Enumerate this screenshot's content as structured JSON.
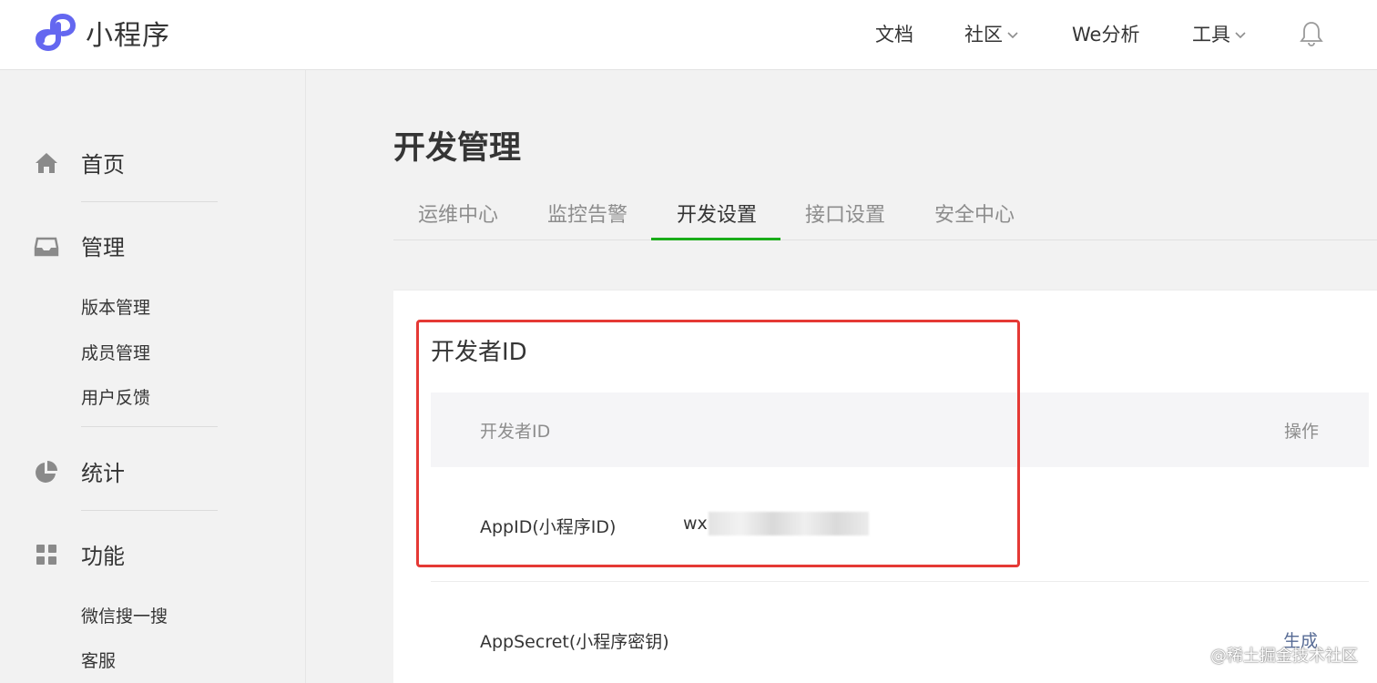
{
  "header": {
    "app_name": "小程序",
    "nav": [
      {
        "label": "文档"
      },
      {
        "label": "社区"
      },
      {
        "label": "We分析"
      },
      {
        "label": "工具"
      }
    ]
  },
  "sidebar": {
    "groups": [
      {
        "label": "首页",
        "icon": "home-icon"
      },
      {
        "label": "管理",
        "icon": "inbox-icon",
        "items": [
          "版本管理",
          "成员管理",
          "用户反馈"
        ]
      },
      {
        "label": "统计",
        "icon": "pie-chart-icon"
      },
      {
        "label": "功能",
        "icon": "grid-icon",
        "items": [
          "微信搜一搜",
          "客服"
        ]
      }
    ]
  },
  "main": {
    "title": "开发管理",
    "tabs": [
      "运维中心",
      "监控告警",
      "开发设置",
      "接口设置",
      "安全中心"
    ],
    "active_tab": "开发设置",
    "section": {
      "title": "开发者ID",
      "columns": [
        "开发者ID",
        "操作"
      ],
      "rows": [
        {
          "label": "AppID(小程序ID)",
          "value": "wx",
          "action": ""
        },
        {
          "label": "AppSecret(小程序密钥)",
          "value": "",
          "action": "生成"
        }
      ]
    }
  },
  "watermark": "@稀土掘金技术社区",
  "colors": {
    "accent": "#1aad19",
    "link": "#576b95",
    "highlight": "#e53935",
    "logo": "#6467f0"
  }
}
